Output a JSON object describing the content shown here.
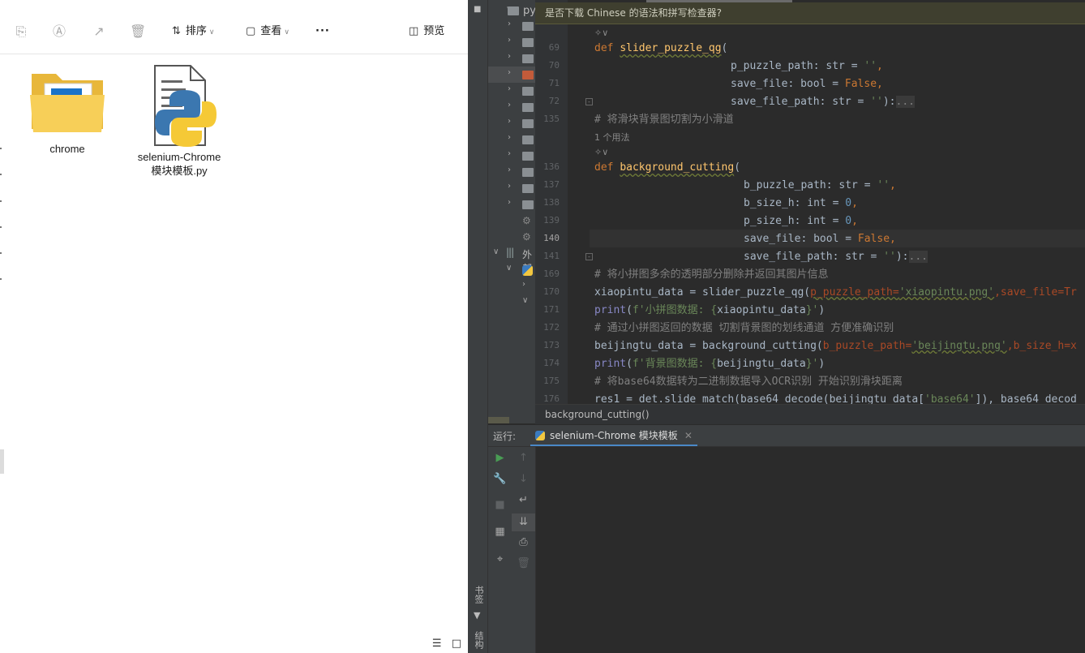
{
  "explorer": {
    "toolbar": {
      "sort_label": "排序",
      "view_label": "查看",
      "more_label": "···",
      "preview_label": "预览"
    },
    "files": [
      {
        "name": "chrome",
        "type": "folder"
      },
      {
        "name": "selenium-Chrome\n模块模板.py",
        "type": "python"
      }
    ]
  },
  "ide": {
    "notification": "是否下载 Chinese 的语法和拼写检查器?",
    "tree_fragments": {
      "top": "py",
      "external": "外部"
    },
    "side_labels": {
      "bookmarks": "书签",
      "structure": "结构"
    },
    "line_numbers": [
      "69",
      "70",
      "71",
      "72",
      "135",
      "136",
      "137",
      "138",
      "139",
      "140",
      "141",
      "169",
      "170",
      "171",
      "172",
      "173",
      "174",
      "175",
      "176"
    ],
    "code": {
      "l69_kw": "def",
      "l69_fn": "slider_puzzle_qg",
      "l69_rest": "(",
      "l70": "p_puzzle_path: str = ",
      "l70_str": "''",
      "l71": "save_file: bool = ",
      "l71_kw": "False",
      "l72": "save_file_path: str = ",
      "l72_str": "''",
      "l72_end": "):",
      "l72_fold": "...",
      "l135": "# 将滑块背景图切割为小滑道",
      "usage_hint": "1 个用法",
      "l136_kw": "def",
      "l136_fn": "background_cutting",
      "l136_rest": "(",
      "l137": "b_puzzle_path: str = ",
      "l137_str": "''",
      "l138": "b_size_h: int = ",
      "l138_num": "0",
      "l139": "p_size_h: int = ",
      "l139_num": "0",
      "l140": "save_file: bool = ",
      "l140_kw": "False",
      "l141": "save_file_path: str = ",
      "l141_str": "''",
      "l141_end": "):",
      "l141_fold": "...",
      "l169": "# 将小拼图多余的透明部分删除并返回其图片信息",
      "l170_a": "xiaopintu_data = slider_puzzle_qg(",
      "l170_b": "p_puzzle_path=",
      "l170_c": "'xiaopintu.png'",
      "l170_d": ",save_file=Tr",
      "l171_a": "print",
      "l171_b": "(",
      "l171_c": "f'小拼图数据: {",
      "l171_d": "xiaopintu_data",
      "l171_e": "}'",
      "l171_f": ")",
      "l172": "# 通过小拼图返回的数据 切割背景图的划线通道 方便准确识别",
      "l173_a": "beijingtu_data = background_cutting(",
      "l173_b": "b_puzzle_path=",
      "l173_c": "'beijingtu.png'",
      "l173_d": ",b_size_h=x",
      "l174_a": "print",
      "l174_b": "(",
      "l174_c": "f'背景图数据: {",
      "l174_d": "beijingtu_data",
      "l174_e": "}'",
      "l174_f": ")",
      "l175": "# 将base64数据转为二进制数据导入OCR识别 开始识别滑块距离",
      "l176_a": "res1 = det.slide_match(base64_decode(beijingtu_data[",
      "l176_b": "'base64'",
      "l176_c": "]), base64_decod"
    },
    "breadcrumb": "background_cutting()",
    "run_panel": {
      "label": "运行:",
      "tab": "selenium-Chrome 模块模板"
    }
  }
}
